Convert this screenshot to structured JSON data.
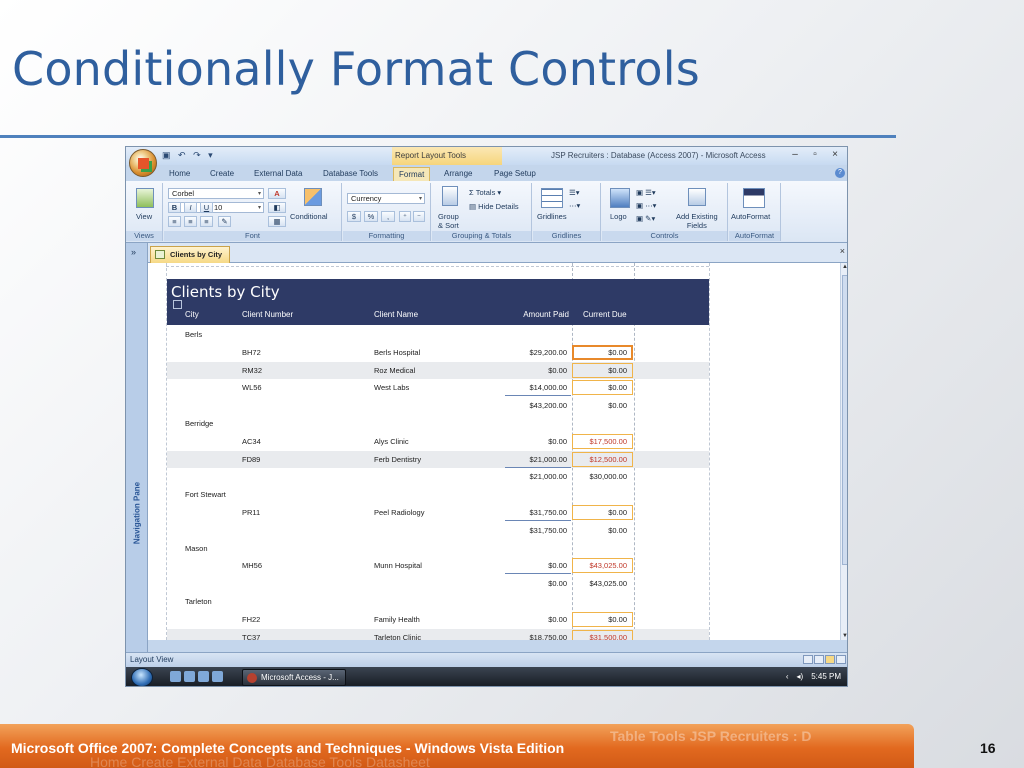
{
  "slide": {
    "title": "Conditionally Format Controls",
    "footer": "Microsoft Office 2007: Complete Concepts and Techniques - Windows Vista Edition",
    "page_number": "16",
    "footer_ghost_top": "Table Tools    JSP Recruiters : D",
    "footer_ghost_bottom": "Home      Create      External Data      Database Tools      Datasheet"
  },
  "window": {
    "qat_icons": [
      "save-icon",
      "undo-icon",
      "redo-icon",
      "customize-icon"
    ],
    "context_label": "Report Layout Tools",
    "title": "JSP Recruiters : Database (Access 2007) - Microsoft Access",
    "controls": [
      "–",
      "▫",
      "×"
    ]
  },
  "tabs": [
    "Home",
    "Create",
    "External Data",
    "Database Tools",
    "Format",
    "Arrange",
    "Page Setup"
  ],
  "active_tab": "Format",
  "ribbon": {
    "views": {
      "label": "View",
      "group": "Views"
    },
    "font": {
      "family": "Corbel",
      "size": "10",
      "bold": "B",
      "italic": "I",
      "underline": "U",
      "font_color": "A",
      "conditional": "Conditional",
      "group": "Font"
    },
    "formatting": {
      "format": "Currency",
      "currency": "$",
      "percent": "%",
      "comma": ",",
      "group": "Formatting"
    },
    "grouping": {
      "group_sort": "Group\n& Sort",
      "totals": "Totals",
      "hide_details": "Hide Details",
      "group": "Grouping & Totals"
    },
    "gridlines": {
      "label": "Gridlines",
      "group": "Gridlines"
    },
    "controls": {
      "logo": "Logo",
      "add_fields": "Add Existing\nFields",
      "group": "Controls"
    },
    "autoformat": {
      "label": "AutoFormat",
      "group": "AutoFormat"
    }
  },
  "nav_pane": {
    "chevron": "»",
    "label": "Navigation Pane"
  },
  "document": {
    "tab": "Clients by City",
    "close": "×"
  },
  "report": {
    "title": "Clients by City",
    "columns": [
      "City",
      "Client Number",
      "Client Name",
      "Amount Paid",
      "Current Due"
    ],
    "rows": [
      {
        "kind": "group",
        "city": "Berls"
      },
      {
        "kind": "detail",
        "number": "BH72",
        "name": "Berls Hospital",
        "paid": "$29,200.00",
        "due": "$0.00",
        "red": false,
        "shade": false,
        "active": true
      },
      {
        "kind": "detail",
        "number": "RM32",
        "name": "Roz Medical",
        "paid": "$0.00",
        "due": "$0.00",
        "red": false,
        "shade": true
      },
      {
        "kind": "detail",
        "number": "WL56",
        "name": "West Labs",
        "paid": "$14,000.00",
        "due": "$0.00",
        "red": false,
        "shade": false
      },
      {
        "kind": "total",
        "paid": "$43,200.00",
        "due": "$0.00"
      },
      {
        "kind": "group",
        "city": "Berridge"
      },
      {
        "kind": "detail",
        "number": "AC34",
        "name": "Alys Clinic",
        "paid": "$0.00",
        "due": "$17,500.00",
        "red": true,
        "shade": false
      },
      {
        "kind": "detail",
        "number": "FD89",
        "name": "Ferb Dentistry",
        "paid": "$21,000.00",
        "due": "$12,500.00",
        "red": true,
        "shade": true
      },
      {
        "kind": "total",
        "paid": "$21,000.00",
        "due": "$30,000.00"
      },
      {
        "kind": "group",
        "city": "Fort Stewart"
      },
      {
        "kind": "detail",
        "number": "PR11",
        "name": "Peel Radiology",
        "paid": "$31,750.00",
        "due": "$0.00",
        "red": false,
        "shade": false
      },
      {
        "kind": "total",
        "paid": "$31,750.00",
        "due": "$0.00"
      },
      {
        "kind": "group",
        "city": "Mason"
      },
      {
        "kind": "detail",
        "number": "MH56",
        "name": "Munn Hospital",
        "paid": "$0.00",
        "due": "$43,025.00",
        "red": true,
        "shade": false
      },
      {
        "kind": "total",
        "paid": "$0.00",
        "due": "$43,025.00"
      },
      {
        "kind": "group",
        "city": "Tarleton"
      },
      {
        "kind": "detail",
        "number": "FH22",
        "name": "Family Health",
        "paid": "$0.00",
        "due": "$0.00",
        "red": false,
        "shade": false
      },
      {
        "kind": "detail",
        "number": "TC37",
        "name": "Tarleton Clinic",
        "paid": "$18,750.00",
        "due": "$31,500.00",
        "red": true,
        "shade": true
      }
    ]
  },
  "status": {
    "text": "Layout View"
  },
  "taskbar": {
    "task": "Microsoft Access - J...",
    "back": "‹",
    "volume": "◂)",
    "time": "5:45 PM"
  },
  "colors": {
    "accent": "#2f5f9e",
    "header_bar": "#2e3a66",
    "footer": "#e2691f",
    "conditional_red": "#c0392b"
  }
}
